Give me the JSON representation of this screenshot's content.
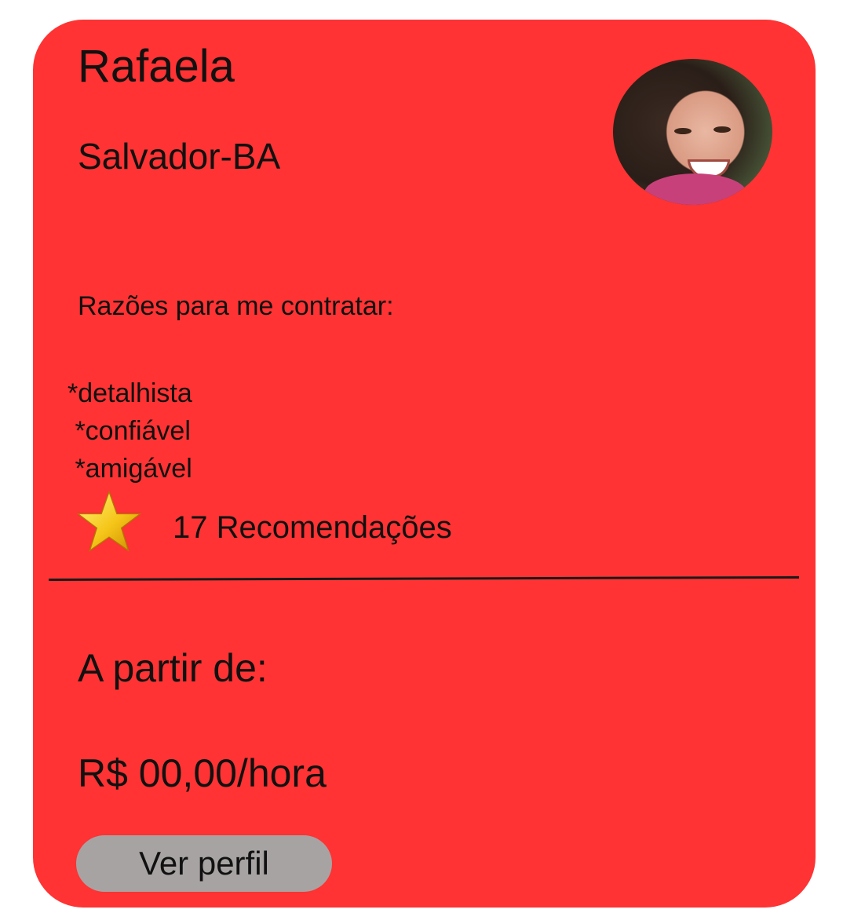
{
  "card": {
    "name": "Rafaela",
    "location": "Salvador-BA",
    "reasons_title": "Razões para me contratar:",
    "reasons": [
      "*detalhista",
      " *confiável",
      " *amigável"
    ],
    "recommendations": "17 Recomendações",
    "price_intro": "A partir de:",
    "price": "R$ 00,00/hora",
    "profile_button": "Ver perfil"
  },
  "colors": {
    "card_background": "#ff3333",
    "button_background": "#a8a3a3",
    "star": "#f5c518"
  }
}
